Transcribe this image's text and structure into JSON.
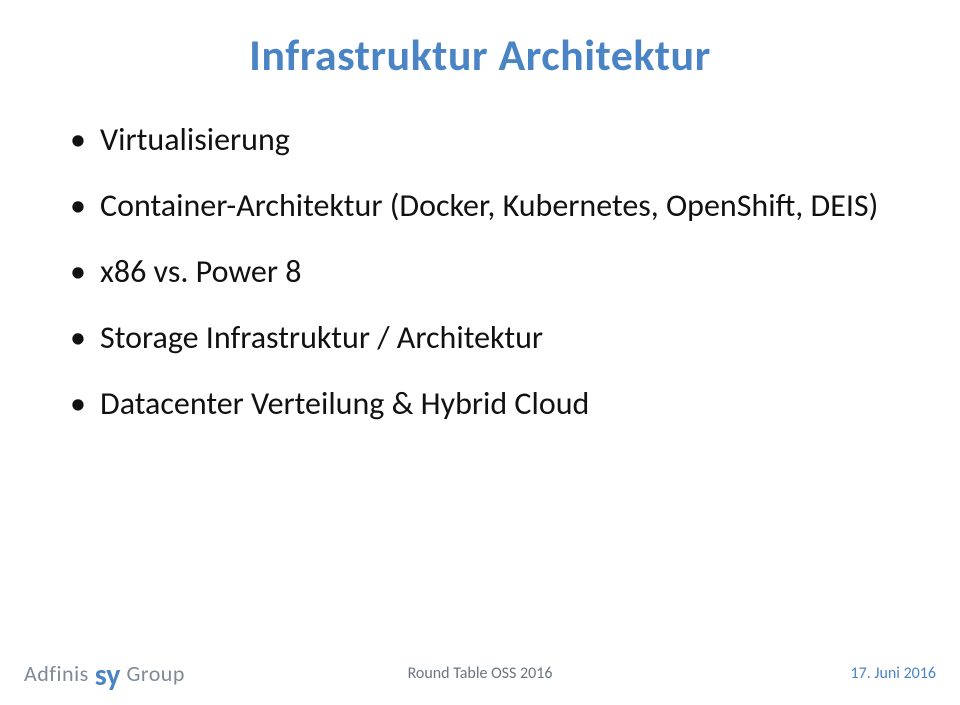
{
  "title": "Infrastruktur Architektur",
  "bullets": [
    "Virtualisierung",
    "Container-Architektur (Docker, Kubernetes, OpenShift, DEIS)",
    "x86 vs. Power 8",
    "Storage Infrastruktur / Architektur",
    "Datacenter Verteilung & Hybrid Cloud"
  ],
  "footer": {
    "logo_left": "Adfinis",
    "logo_mid": "sy",
    "logo_right": "Group",
    "center": "Round Table OSS  2016",
    "date": "17. Juni 2016"
  }
}
